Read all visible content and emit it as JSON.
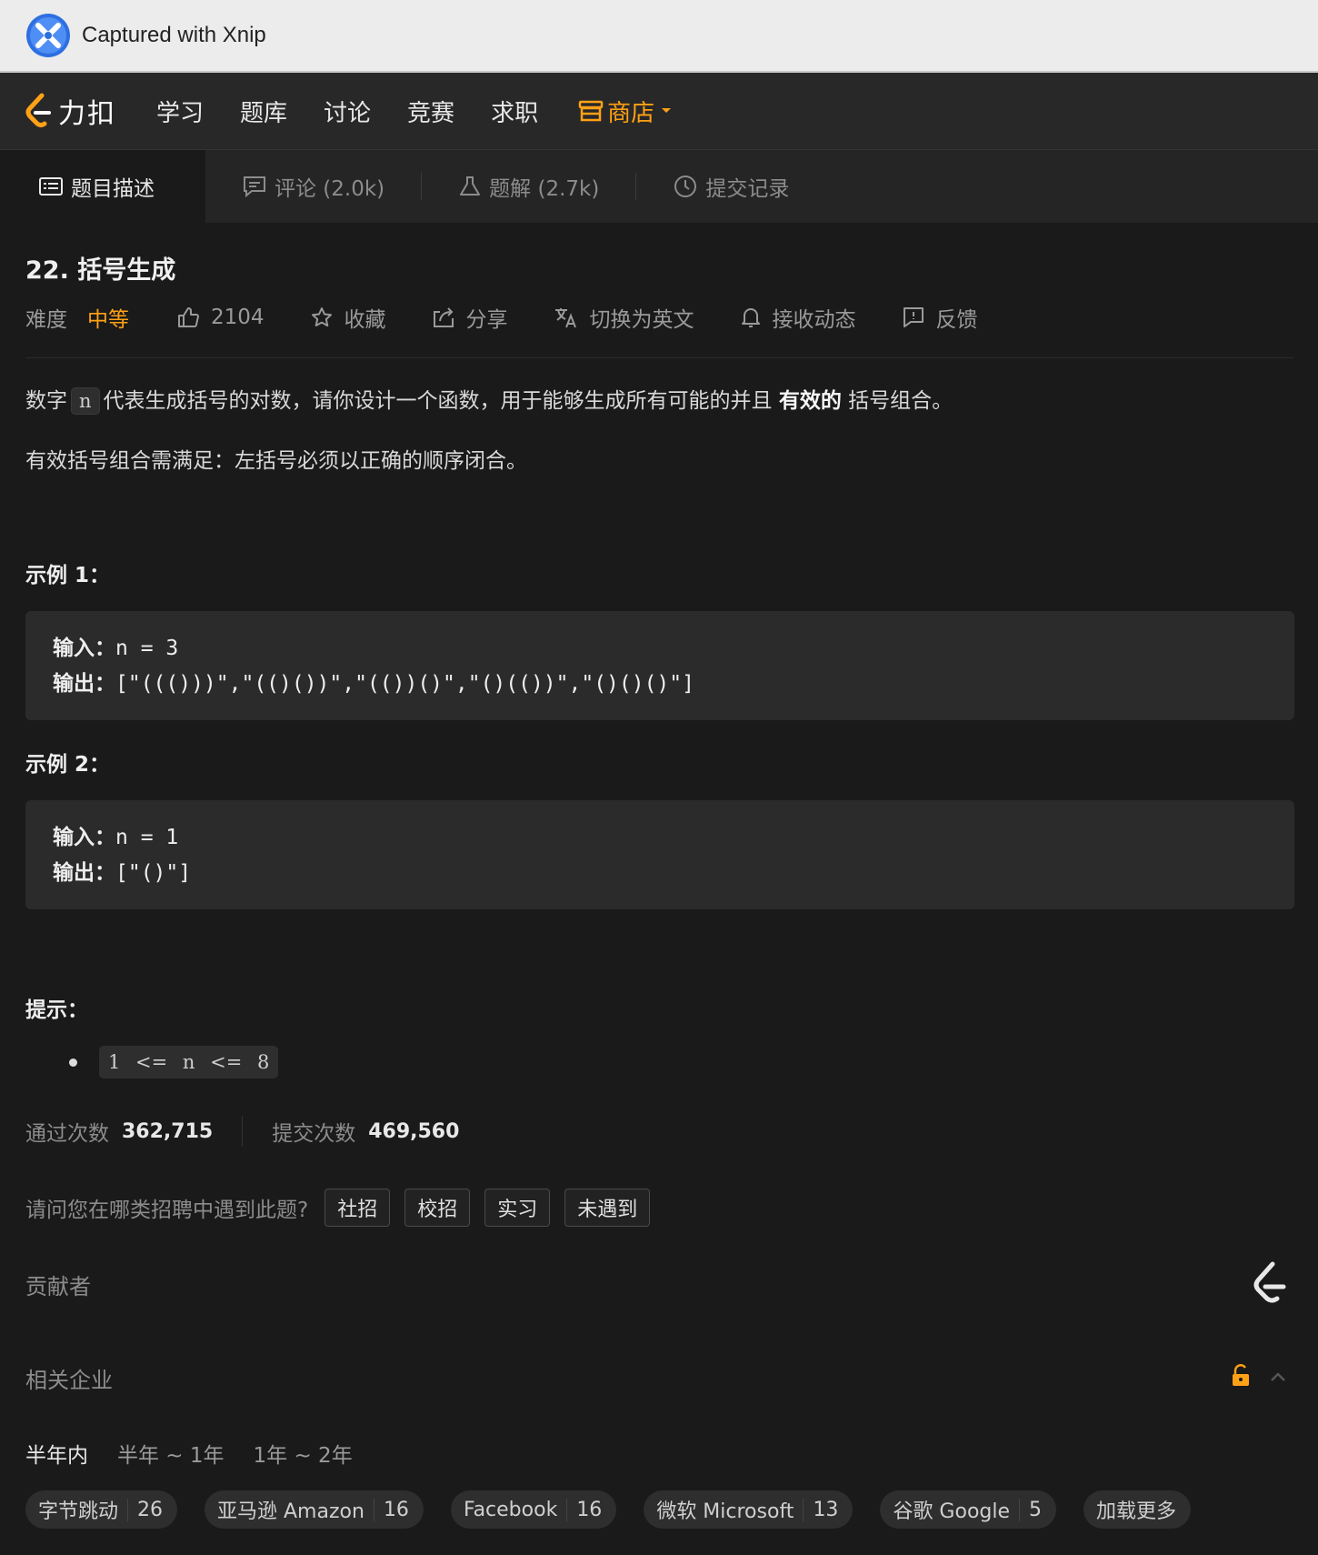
{
  "xnip": {
    "title": "Captured with Xnip"
  },
  "topnav": {
    "brand": "力扣",
    "items": [
      "学习",
      "题库",
      "讨论",
      "竞赛",
      "求职"
    ],
    "shop": "商店"
  },
  "tabs": [
    {
      "label": "题目描述",
      "icon": "description-icon"
    },
    {
      "label": "评论 (2.0k)",
      "icon": "comment-icon"
    },
    {
      "label": "题解 (2.7k)",
      "icon": "flask-icon"
    },
    {
      "label": "提交记录",
      "icon": "clock-icon"
    }
  ],
  "problem": {
    "title": "22. 括号生成",
    "difficulty_label": "难度",
    "difficulty": "中等",
    "likes": "2104",
    "favorite": "收藏",
    "share": "分享",
    "switch_lang": "切换为英文",
    "subscribe": "接收动态",
    "feedback": "反馈",
    "desc_a": "数字",
    "desc_code": "n",
    "desc_b": "代表生成括号的对数，请你设计一个函数，用于能够生成所有可能的并且",
    "desc_bold": "有效的",
    "desc_c": "括号组合。",
    "desc2": "有效括号组合需满足：左括号必须以正确的顺序闭合。",
    "examples": [
      {
        "heading": "示例 1：",
        "in_label": "输入：",
        "input": "n = 3",
        "out_label": "输出：",
        "output": "[\"((()))\",\"(()())\",\"(())()\",\"()(())\",\"()()()\"]"
      },
      {
        "heading": "示例 2：",
        "in_label": "输入：",
        "input": "n = 1",
        "out_label": "输出：",
        "output": "[\"()\"]"
      }
    ],
    "hint_heading": "提示：",
    "hint": "1 <= n <= 8"
  },
  "stats": {
    "accepted_label": "通过次数",
    "accepted": "362,715",
    "submitted_label": "提交次数",
    "submitted": "469,560"
  },
  "survey": {
    "question": "请问您在哪类招聘中遇到此题?",
    "options": [
      "社招",
      "校招",
      "实习",
      "未遇到"
    ]
  },
  "contributors": {
    "label": "贡献者"
  },
  "companies": {
    "label": "相关企业",
    "periods": [
      "半年内",
      "半年 ~ 1年",
      "1年 ~ 2年"
    ],
    "list": [
      {
        "name": "字节跳动",
        "count": "26"
      },
      {
        "name": "亚马逊 Amazon",
        "count": "16"
      },
      {
        "name": "Facebook",
        "count": "16"
      },
      {
        "name": "微软 Microsoft",
        "count": "13"
      },
      {
        "name": "谷歌 Google",
        "count": "5"
      }
    ],
    "more": "加载更多"
  },
  "colors": {
    "accent": "#ffa116",
    "bg": "#1a1a1a",
    "nav": "#282828"
  }
}
